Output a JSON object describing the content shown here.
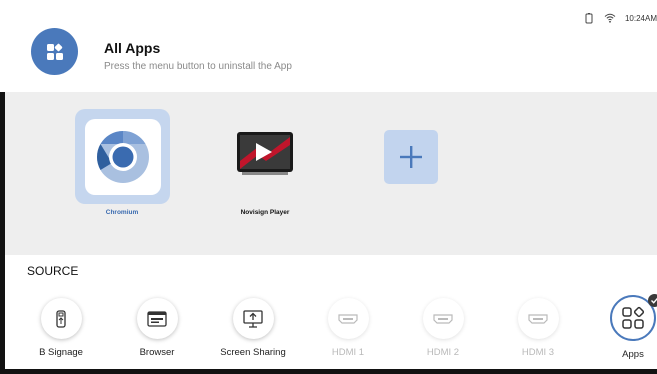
{
  "status_bar": {
    "time": "10:24AM",
    "icons": [
      "sim-icon",
      "wifi-icon"
    ]
  },
  "header": {
    "icon": "apps-grid-icon",
    "title": "All Apps",
    "subtitle": "Press the menu button to uninstall the App"
  },
  "apps": [
    {
      "label": "Chromium",
      "icon": "chromium-icon",
      "selected": true
    },
    {
      "label": "Novisign Player",
      "icon": "novisign-player-icon",
      "selected": false
    },
    {
      "label": "",
      "icon": "add-icon",
      "selected": false
    }
  ],
  "source": {
    "title": "SOURCE",
    "items": [
      {
        "label": "B Signage",
        "icon": "usb-icon",
        "enabled": true
      },
      {
        "label": "Browser",
        "icon": "browser-icon",
        "enabled": true
      },
      {
        "label": "Screen Sharing",
        "icon": "screen-share-icon",
        "enabled": true
      },
      {
        "label": "HDMI 1",
        "icon": "hdmi-icon",
        "enabled": false
      },
      {
        "label": "HDMI 2",
        "icon": "hdmi-icon",
        "enabled": false
      },
      {
        "label": "HDMI 3",
        "icon": "hdmi-icon",
        "enabled": false
      },
      {
        "label": "Apps",
        "icon": "apps-icon",
        "enabled": true,
        "active": true
      }
    ]
  },
  "colors": {
    "accent": "#4a79bb",
    "selected_tile": "#c5d6ee",
    "panel_bg": "#eeeeee",
    "disabled_text": "#b9b9b9"
  }
}
